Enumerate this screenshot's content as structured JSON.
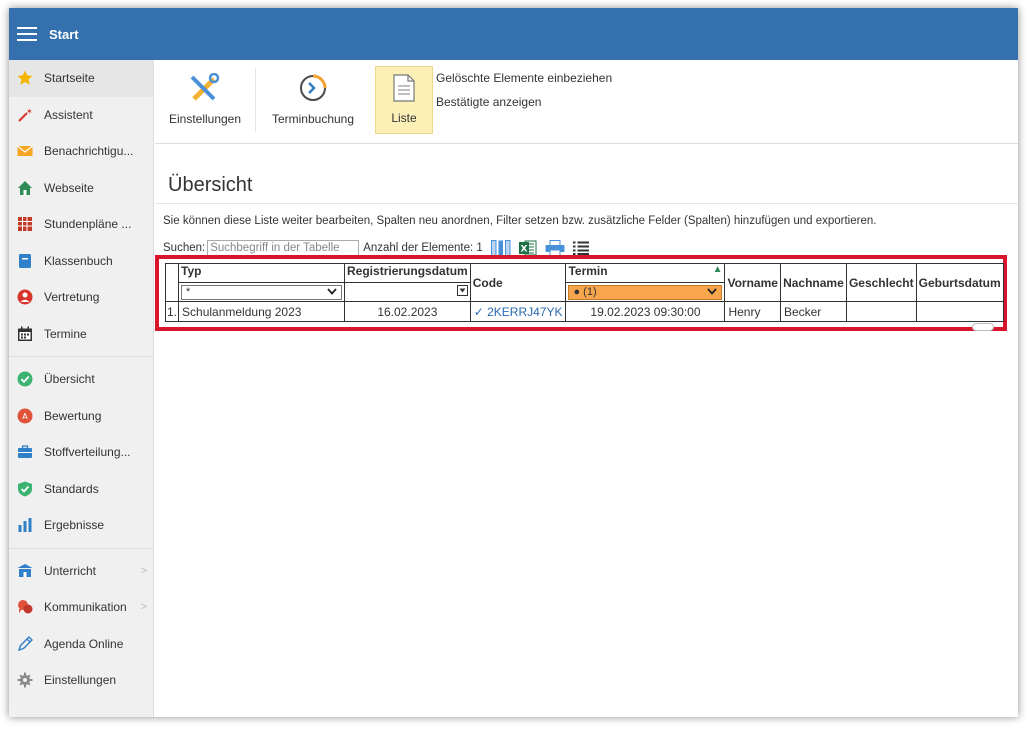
{
  "app": {
    "title": "Start"
  },
  "sidebar": {
    "items": [
      {
        "label": "Startseite",
        "icon": "star-icon"
      },
      {
        "label": "Assistent",
        "icon": "wand-icon"
      },
      {
        "label": "Benachrichtigu...",
        "icon": "envelope-icon"
      },
      {
        "label": "Webseite",
        "icon": "home-icon"
      },
      {
        "label": "Stundenpläne ...",
        "icon": "timetable-icon"
      },
      {
        "label": "Klassenbuch",
        "icon": "book-icon"
      },
      {
        "label": "Vertretung",
        "icon": "person-icon"
      },
      {
        "label": "Termine",
        "icon": "calendar-icon"
      },
      {
        "label": "Übersicht",
        "icon": "check-circle-icon"
      },
      {
        "label": "Bewertung",
        "icon": "rating-icon"
      },
      {
        "label": "Stoffverteilung...",
        "icon": "briefcase-icon"
      },
      {
        "label": "Standards",
        "icon": "shield-check-icon"
      },
      {
        "label": "Ergebnisse",
        "icon": "bar-chart-icon"
      },
      {
        "label": "Unterricht",
        "icon": "classroom-icon"
      },
      {
        "label": "Kommunikation",
        "icon": "chat-icon"
      },
      {
        "label": "Agenda Online",
        "icon": "pen-icon"
      },
      {
        "label": "Einstellungen",
        "icon": "gear-icon"
      }
    ]
  },
  "ribbon": {
    "buttons": [
      {
        "label": "Einstellungen",
        "icon": "tools-icon"
      },
      {
        "label": "Terminbuchung",
        "icon": "clock-icon"
      },
      {
        "label": "Liste",
        "icon": "document-icon"
      }
    ],
    "options": [
      "Gelöschte Elemente einbeziehen",
      "Bestätigte anzeigen"
    ]
  },
  "main": {
    "title": "Übersicht",
    "description": "Sie können diese Liste weiter bearbeiten, Spalten neu anordnen, Filter setzen bzw. zusätzliche Felder (Spalten) hinzufügen und exportieren.",
    "search_label": "Suchen:",
    "search_placeholder": "Suchbegriff in der Tabelle",
    "count_label": "Anzahl der Elemente: 1"
  },
  "table": {
    "columns": [
      "Typ",
      "Registrierungsdatum",
      "Code",
      "Termin",
      "Vorname",
      "Nachname",
      "Geschlecht",
      "Geburtsdatum"
    ],
    "filters": {
      "typ": "*",
      "termin": "● (1)"
    },
    "rows": [
      {
        "num": "1.",
        "typ": "Schulanmeldung 2023",
        "datum": "16.02.2023",
        "code": "✓ 2KERRJ47YK",
        "termin": "19.02.2023 09:30:00",
        "vorname": "Henry",
        "nachname": "Becker",
        "geschlecht": "",
        "geburtsdatum": ""
      }
    ]
  },
  "colors": {
    "topbar": "#3470ae",
    "highlight": "#d8152b",
    "filter_active": "#f7a64d",
    "selected_button": "#fdf0b7"
  }
}
